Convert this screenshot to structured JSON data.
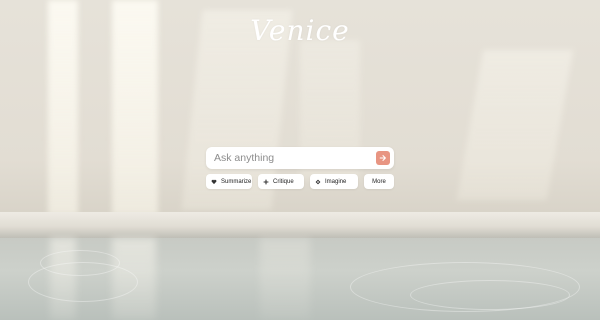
{
  "brand": {
    "logo_text": "Venice"
  },
  "search": {
    "placeholder": "Ask anything",
    "value": ""
  },
  "send_button": {
    "icon": "arrow-right-icon",
    "color": "#e89582"
  },
  "chips": [
    {
      "label": "Summarize",
      "icon": "heart-icon"
    },
    {
      "label": "Critique",
      "icon": "plus-icon"
    },
    {
      "label": "Imagine",
      "icon": "eye-icon"
    },
    {
      "label": "More"
    }
  ]
}
